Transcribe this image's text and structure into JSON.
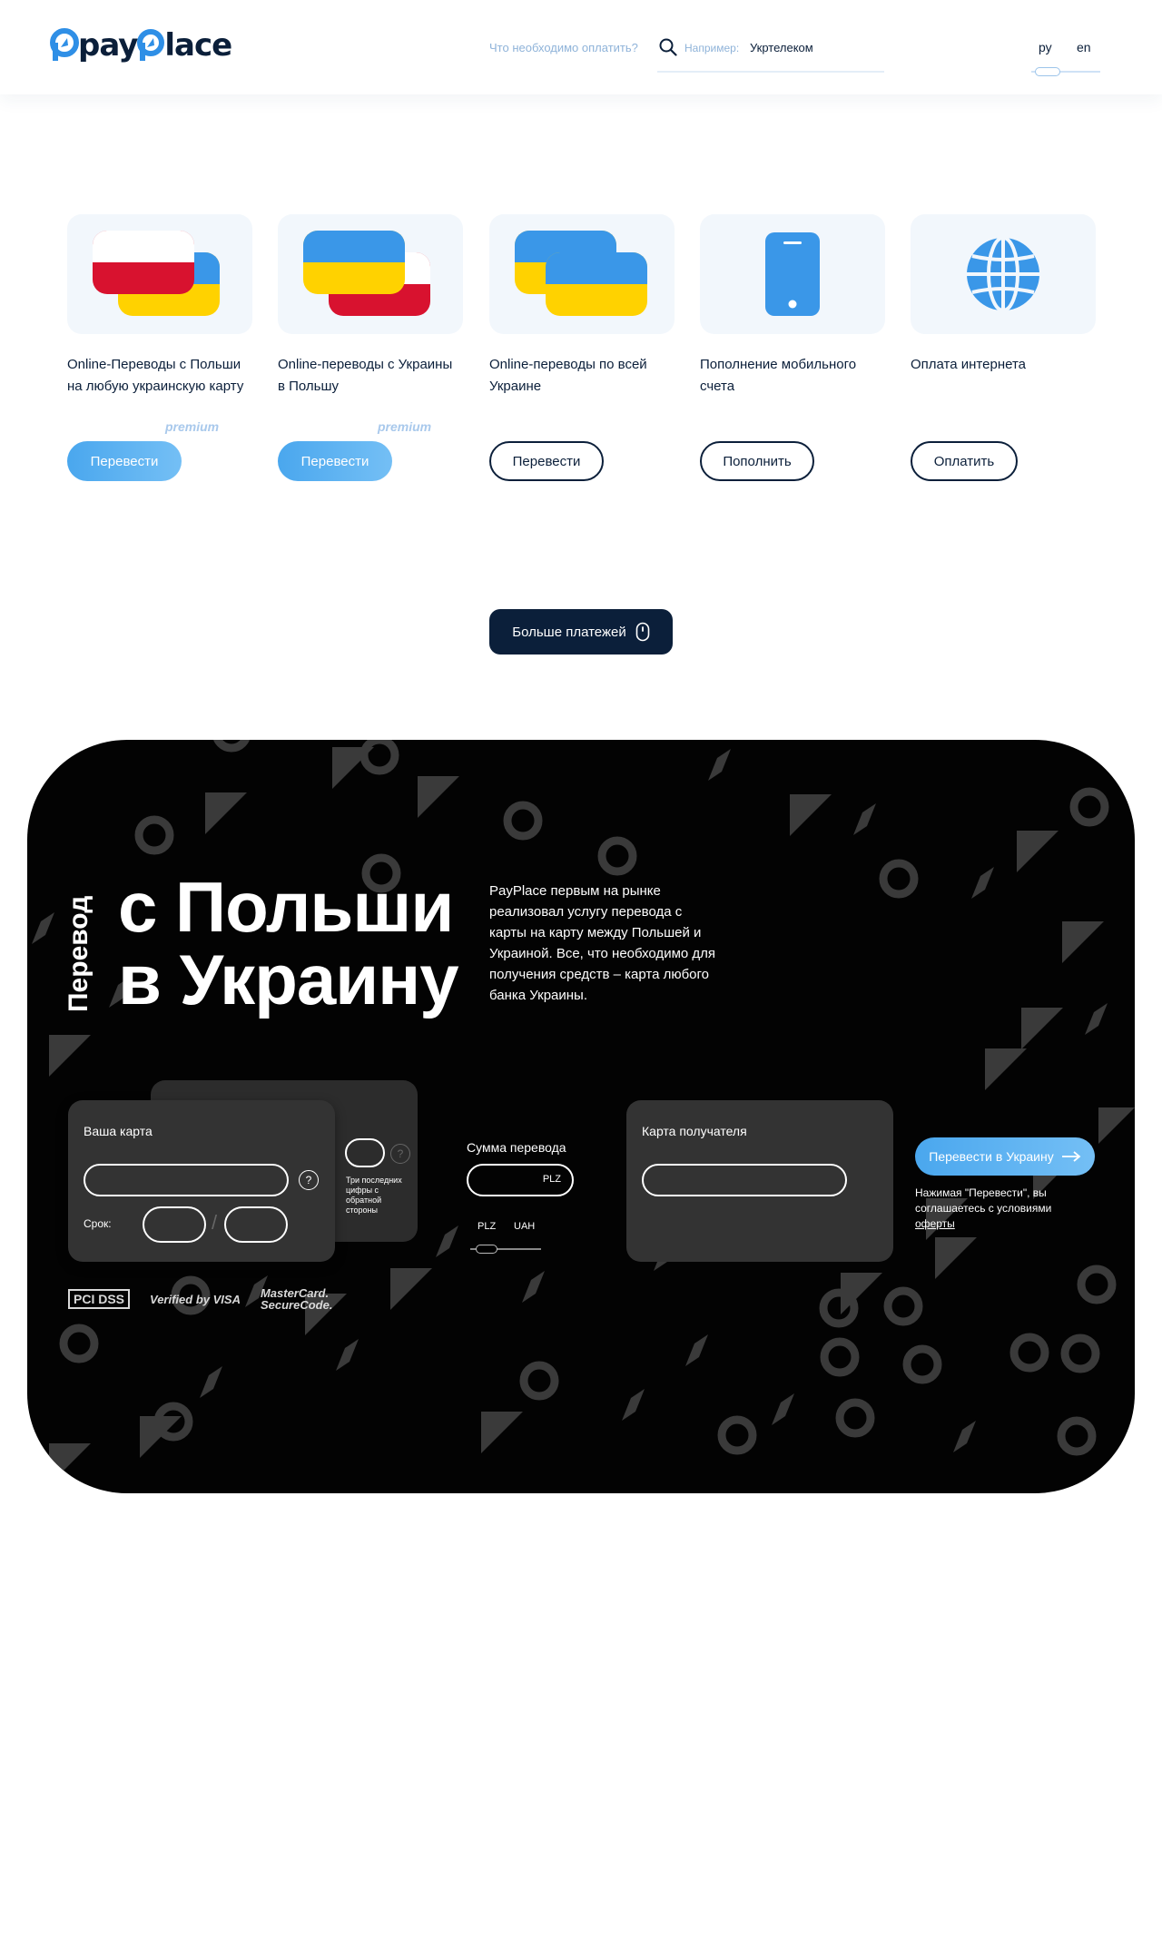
{
  "header": {
    "logo_a": "pay",
    "logo_b": "lace",
    "search_prompt": "Что необходимо оплатить?",
    "search_hint": "Например:",
    "search_value": "Укртелеком",
    "langs": [
      "ру",
      "en"
    ]
  },
  "services": [
    {
      "title": "Online-Переводы с Польши на любую украинскую карту",
      "button": "Перевести",
      "premium": "premium"
    },
    {
      "title": "Online-переводы с Украины в Польшу",
      "button": "Перевести",
      "premium": "premium"
    },
    {
      "title": "Online-переводы по всей Украине",
      "button": "Перевести"
    },
    {
      "title": "Пополнение мобильного счета",
      "button": "Пополнить"
    },
    {
      "title": "Оплата интернета",
      "button": "Оплатить"
    }
  ],
  "more_button": "Больше платежей",
  "transfer": {
    "vertical_label": "Перевод",
    "headline_1": "с Польши",
    "headline_2": "в Украину",
    "description": "PayPlace первым на рынке реализовал услугу перевода с карты на карту между Польшей и Украиной. Все, что необходимо для получения средств – карта любого банка Украины.",
    "your_card": "Ваша карта",
    "expiry": "Срок:",
    "cvv_note": "Три последних цифры с обратной стороны",
    "amount_label": "Сумма перевода",
    "currency": "PLZ",
    "currency_options": [
      "PLZ",
      "UAH"
    ],
    "recipient_card": "Карта получателя",
    "send_button": "Перевести в Украину",
    "agree_text": "Нажимая \"Перевести\", вы соглашаетесь с условиями",
    "agree_link": "оферты",
    "security_logos": [
      "PCI DSS",
      "Verified by VISA",
      "MasterCard. SecureCode."
    ]
  },
  "colors": {
    "navy": "#0b1f3a",
    "accent_blue": "#4aa7ee",
    "tile_bg": "#f2f7fc",
    "dark_bg": "#030303"
  }
}
